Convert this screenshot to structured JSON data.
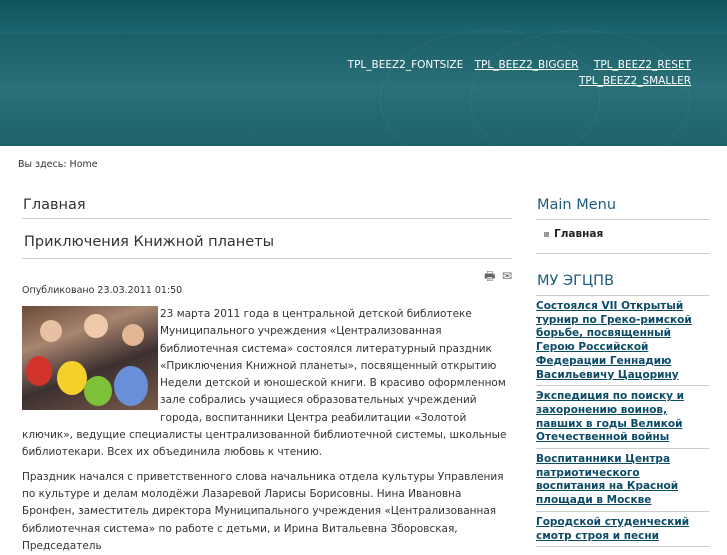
{
  "header": {
    "fontsize_label": "TPL_BEEZ2_FONTSIZE",
    "bigger": "TPL_BEEZ2_BIGGER",
    "reset": "TPL_BEEZ2_RESET",
    "smaller": "TPL_BEEZ2_SMALLER"
  },
  "breadcrumb": {
    "text": "Вы здесь: Home"
  },
  "main": {
    "page_heading": "Главная",
    "article_title": "Приключения Книжной планеты",
    "print_icon": "print-icon",
    "email_icon": "email-icon",
    "published": "Опубликовано 23.03.2011 01:50",
    "paragraph1": "23 марта 2011 года в центральной детской библиотеке Муниципального учреждения «Централизованная библиотечная система» состоялся литературный праздник «Приключения Книжной планеты», посвященный открытию Недели детской и юношеской книги. В красиво оформленном зале собрались учащиеся образовательных учреждений города, воспитанники Центра реабилитации «Золотой ключик», ведущие специалисты централизованной библиотечной системы, школьные библиотекари. Всех их объединила любовь к чтению.",
    "paragraph2": "Праздник начался с приветственного слова начальника отдела культуры Управления по культуре и делам молодёжи Лазаревой Ларисы Борисовны. Нина Ивановна Бронфен, заместитель директора Муниципального учреждения «Централизованная библиотечная система» по работе с детьми, и Ирина Витальевна Зборовская, Председатель"
  },
  "sidebar": {
    "menu_title": "Main Menu",
    "menu_items": [
      {
        "label": "Главная"
      }
    ],
    "news_title": "МУ ЭГЦПВ",
    "news": [
      {
        "title": "Состоялся VII Открытый турнир по Греко-римской борьбе, посвященный Герою Российской Федерации Геннадию Васильевичу Цацорину"
      },
      {
        "title": "Экспедиция по поиску и захоронению воинов, павших в годы Великой Отечественной войны"
      },
      {
        "title": "Воспитанники Центра патриотического воспитания на Красной площади в Москве"
      },
      {
        "title": "Городской студенческий смотр строя и песни"
      }
    ]
  }
}
